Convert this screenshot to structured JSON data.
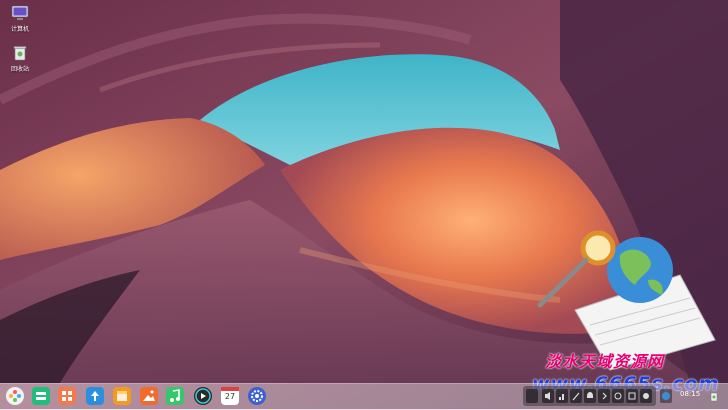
{
  "desktop": {
    "icons": [
      {
        "label": "计算机",
        "icon": "computer-icon"
      },
      {
        "label": "回收站",
        "icon": "trash-icon"
      }
    ]
  },
  "watermark": {
    "chinese": "淡水天域资源网",
    "url": "www.6665s.com"
  },
  "dock": {
    "apps": [
      {
        "icon": "launcher-icon",
        "color": "#f2f2f2"
      },
      {
        "icon": "multitask-view-icon",
        "color": "#1fbf7a"
      },
      {
        "icon": "app-store-icon",
        "color": "#f27a4a"
      },
      {
        "icon": "file-manager-icon",
        "color": "#2b8fe0"
      },
      {
        "icon": "package-icon",
        "color": "#f49a20"
      },
      {
        "icon": "image-viewer-icon",
        "color": "#f26b2e"
      },
      {
        "icon": "music-icon",
        "color": "#36c76a"
      },
      {
        "icon": "video-player-icon",
        "color": "#2a2a2a"
      },
      {
        "icon": "calendar-icon",
        "color": "#ffffff",
        "text": "27"
      },
      {
        "icon": "settings-icon",
        "color": "#3c5fd6"
      }
    ],
    "clock": "08:15"
  }
}
